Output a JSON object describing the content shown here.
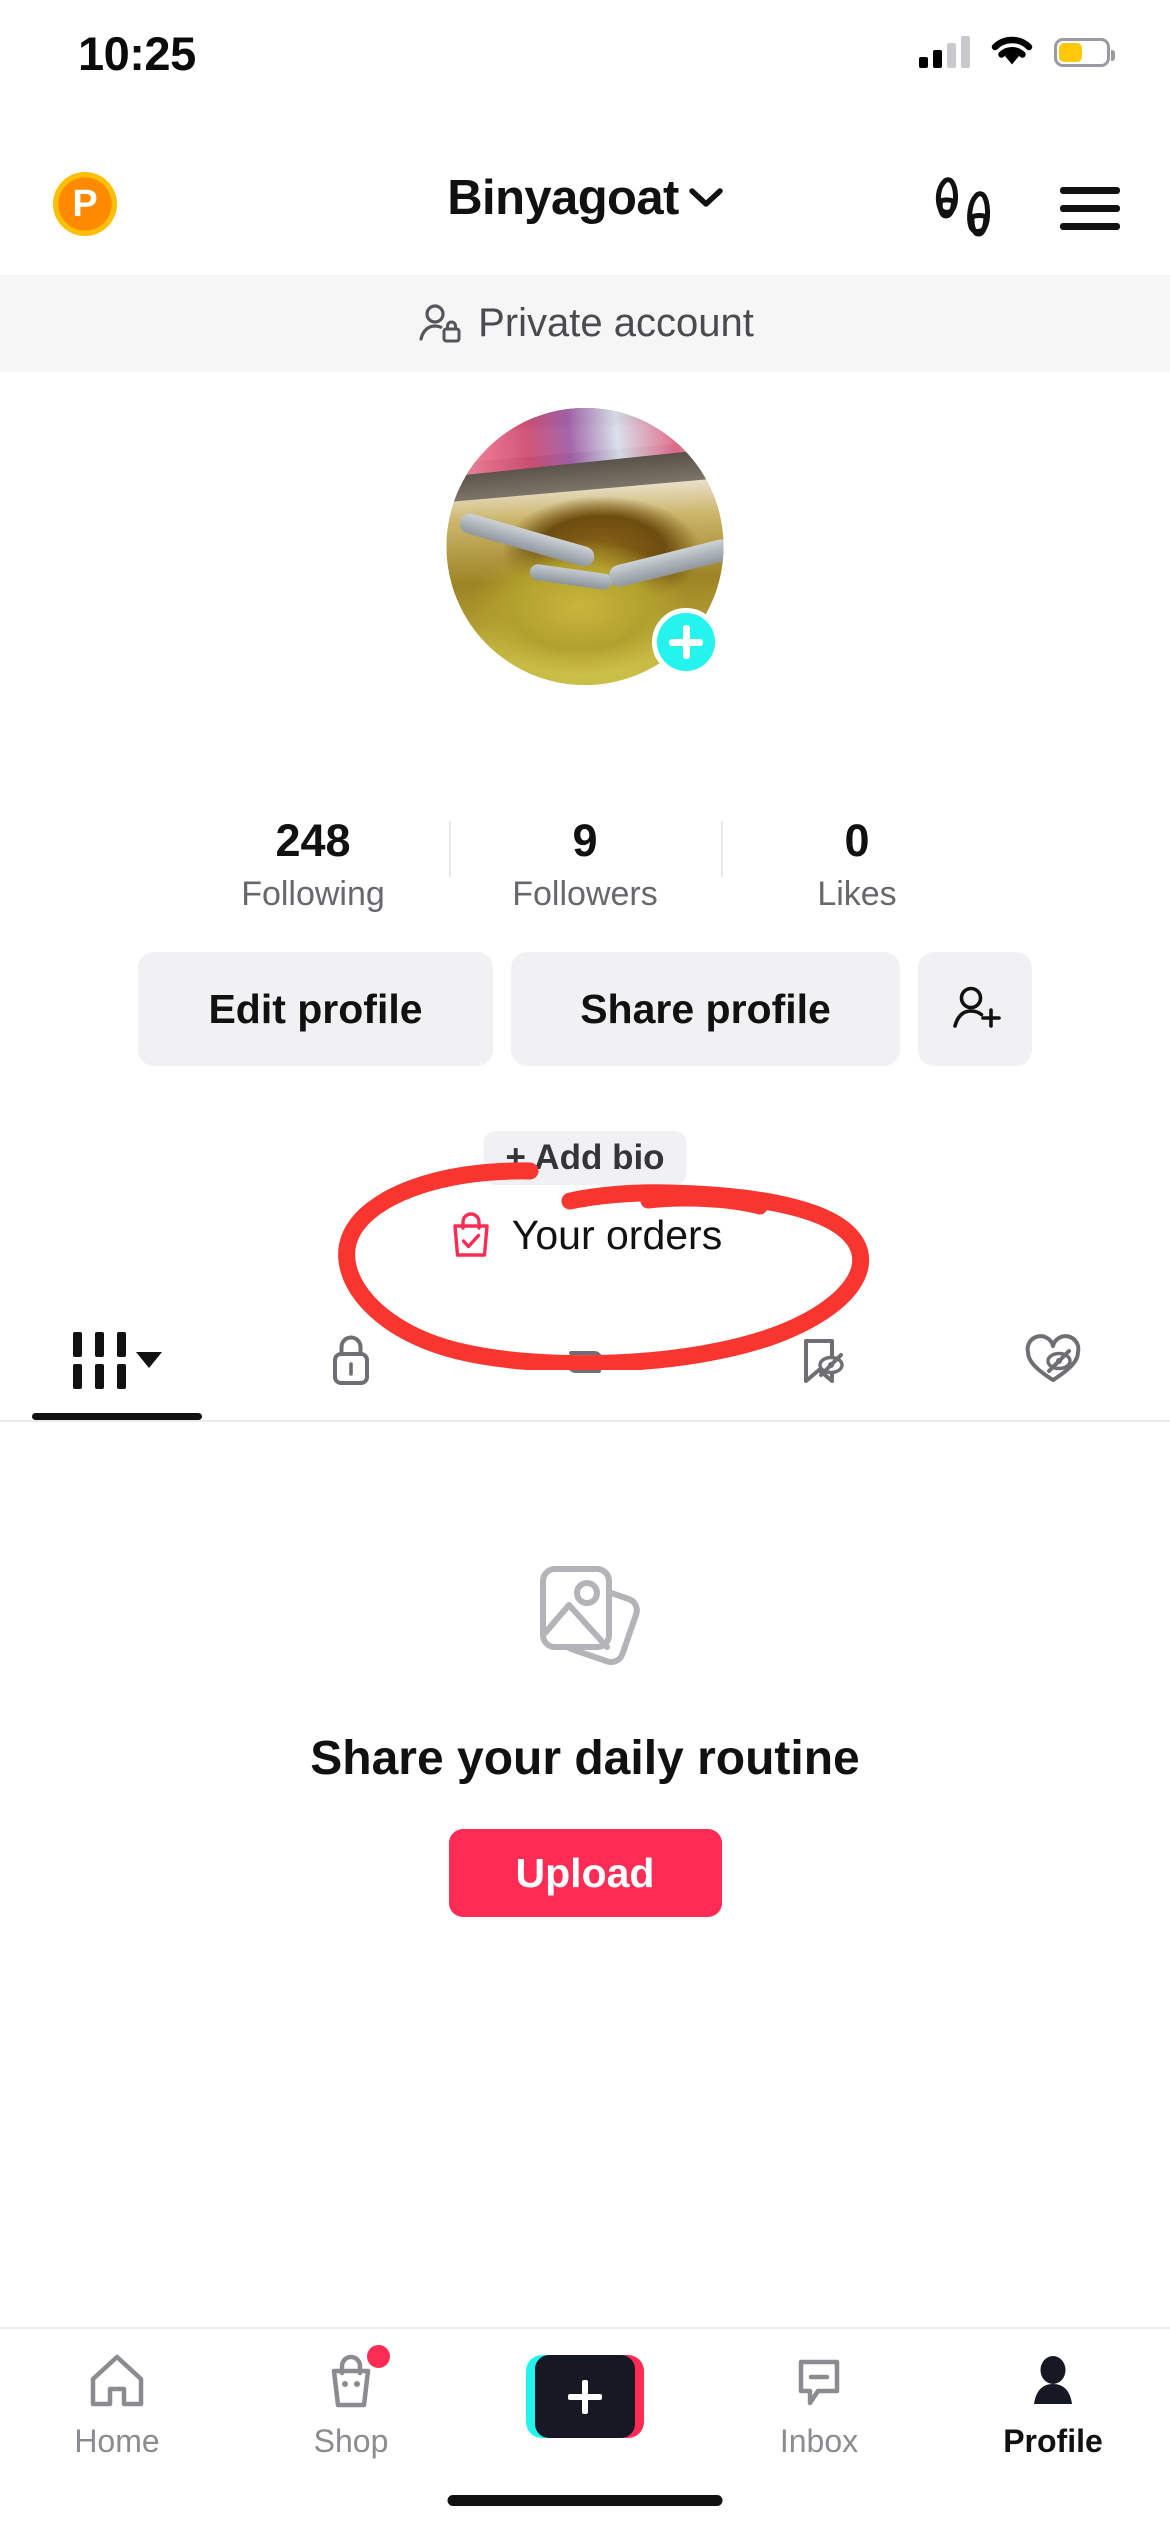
{
  "status_bar": {
    "time": "10:25",
    "signal_bars_active": 2,
    "signal_bars_total": 4,
    "wifi": "wifi-icon",
    "battery_percent": 50,
    "battery_color": "#FFC90A"
  },
  "header": {
    "coin_badge_letter": "P",
    "username": "Binyagoat",
    "dropdown_icon": "chevron-down-icon",
    "footprints_icon": "footprints-icon",
    "menu_icon": "hamburger-menu-icon"
  },
  "private_banner": {
    "icon": "person-lock-icon",
    "label": "Private account"
  },
  "profile": {
    "avatar_alt": "instant noodles in a bowl with spoons",
    "add_story_icon": "plus-icon",
    "stats": [
      {
        "value": "248",
        "label": "Following"
      },
      {
        "value": "9",
        "label": "Followers"
      },
      {
        "value": "0",
        "label": "Likes"
      }
    ],
    "actions": {
      "edit_profile": "Edit profile",
      "share_profile": "Share profile",
      "add_friend_icon": "add-friend-icon"
    },
    "add_bio": "+ Add bio",
    "your_orders": {
      "icon": "shopping-bag-check-icon",
      "icon_color": "#FE2C55",
      "label": "Your orders"
    }
  },
  "tabs": [
    {
      "name": "posts",
      "icon": "grid-icon",
      "active": true,
      "has_dropdown": true
    },
    {
      "name": "private",
      "icon": "lock-icon",
      "active": false
    },
    {
      "name": "reposts",
      "icon": "repost-icon",
      "active": false
    },
    {
      "name": "favorites",
      "icon": "bookmark-hidden-icon",
      "active": false
    },
    {
      "name": "liked",
      "icon": "heart-hidden-icon",
      "active": false
    }
  ],
  "empty_state": {
    "icon": "photos-stack-icon",
    "headline": "Share your daily routine",
    "button_label": "Upload",
    "button_color": "#FE2C55"
  },
  "annotation": {
    "shape": "hand-drawn-red-ellipse",
    "color": "#F8352F",
    "targets": "Your orders"
  },
  "bottom_nav": [
    {
      "label": "Home",
      "icon": "home-icon",
      "active": false,
      "badge": false
    },
    {
      "label": "Shop",
      "icon": "shop-bag-icon",
      "active": false,
      "badge": true
    },
    {
      "label": "",
      "icon": "create-plus-icon",
      "active": false,
      "badge": false
    },
    {
      "label": "Inbox",
      "icon": "inbox-message-icon",
      "active": false,
      "badge": false
    },
    {
      "label": "Profile",
      "icon": "profile-person-icon",
      "active": true,
      "badge": false
    }
  ]
}
